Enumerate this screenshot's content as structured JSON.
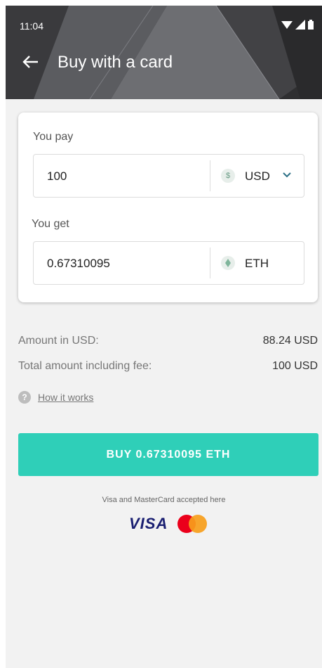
{
  "status_bar": {
    "time": "11:04"
  },
  "header": {
    "title": "Buy with a card",
    "back_icon": "arrow-left-icon"
  },
  "form": {
    "pay_label": "You pay",
    "pay_value": "100",
    "pay_currency": "USD",
    "pay_currency_icon": "$",
    "get_label": "You get",
    "get_value": "0.67310095",
    "get_currency": "ETH"
  },
  "summary": {
    "amount_label": "Amount in USD:",
    "amount_value": "88.24 USD",
    "total_label": "Total amount including fee:",
    "total_value": "100 USD"
  },
  "help": {
    "icon": "?",
    "link_text": "How it works"
  },
  "buy_button": {
    "label": "BUY 0.67310095 ETH"
  },
  "payment": {
    "accepted_text": "Visa and MasterCard accepted here",
    "visa_label": "VISA"
  },
  "colors": {
    "accent": "#2fcfb8",
    "header_bg": "#2f2f31",
    "mastercard_red": "#eb001b",
    "mastercard_orange": "#f79e1b"
  }
}
